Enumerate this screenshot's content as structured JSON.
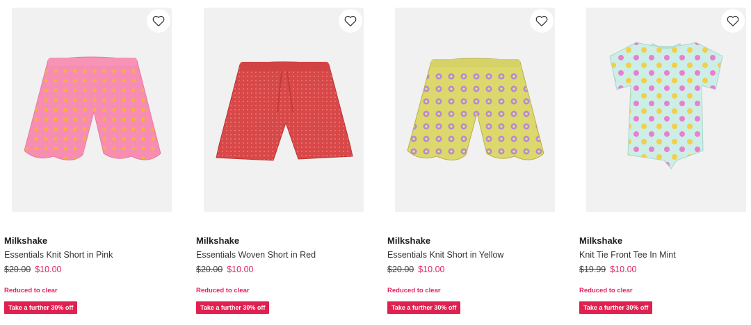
{
  "products": [
    {
      "brand": "Milkshake",
      "name": "Essentials Knit Short in Pink",
      "price_was": "$20.00",
      "price_now": "$10.00",
      "badge": "Reduced to clear",
      "promo": "Take a further 30% off",
      "image": "pink-ruffle-shorts",
      "color": "#f58fb0"
    },
    {
      "brand": "Milkshake",
      "name": "Essentials Woven Short in Red",
      "price_was": "$20.00",
      "price_now": "$10.00",
      "badge": "Reduced to clear",
      "promo": "Take a further 30% off",
      "image": "red-woven-shorts",
      "color": "#d64545"
    },
    {
      "brand": "Milkshake",
      "name": "Essentials Knit Short in Yellow",
      "price_was": "$20.00",
      "price_now": "$10.00",
      "badge": "Reduced to clear",
      "promo": "Take a further 30% off",
      "image": "yellow-ruffle-shorts",
      "color": "#d9d66a"
    },
    {
      "brand": "Milkshake",
      "name": "Knit Tie Front Tee In Mint",
      "price_was": "$19.99",
      "price_now": "$10.00",
      "badge": "Reduced to clear",
      "promo": "Take a further 30% off",
      "image": "mint-tie-front-tee",
      "color": "#cdeee6"
    }
  ],
  "icons": {
    "wishlist": "heart-outline-icon"
  },
  "colors": {
    "sale": "#e0245e",
    "promo_bg": "#e0204f",
    "image_bg": "#f1f1f1"
  }
}
